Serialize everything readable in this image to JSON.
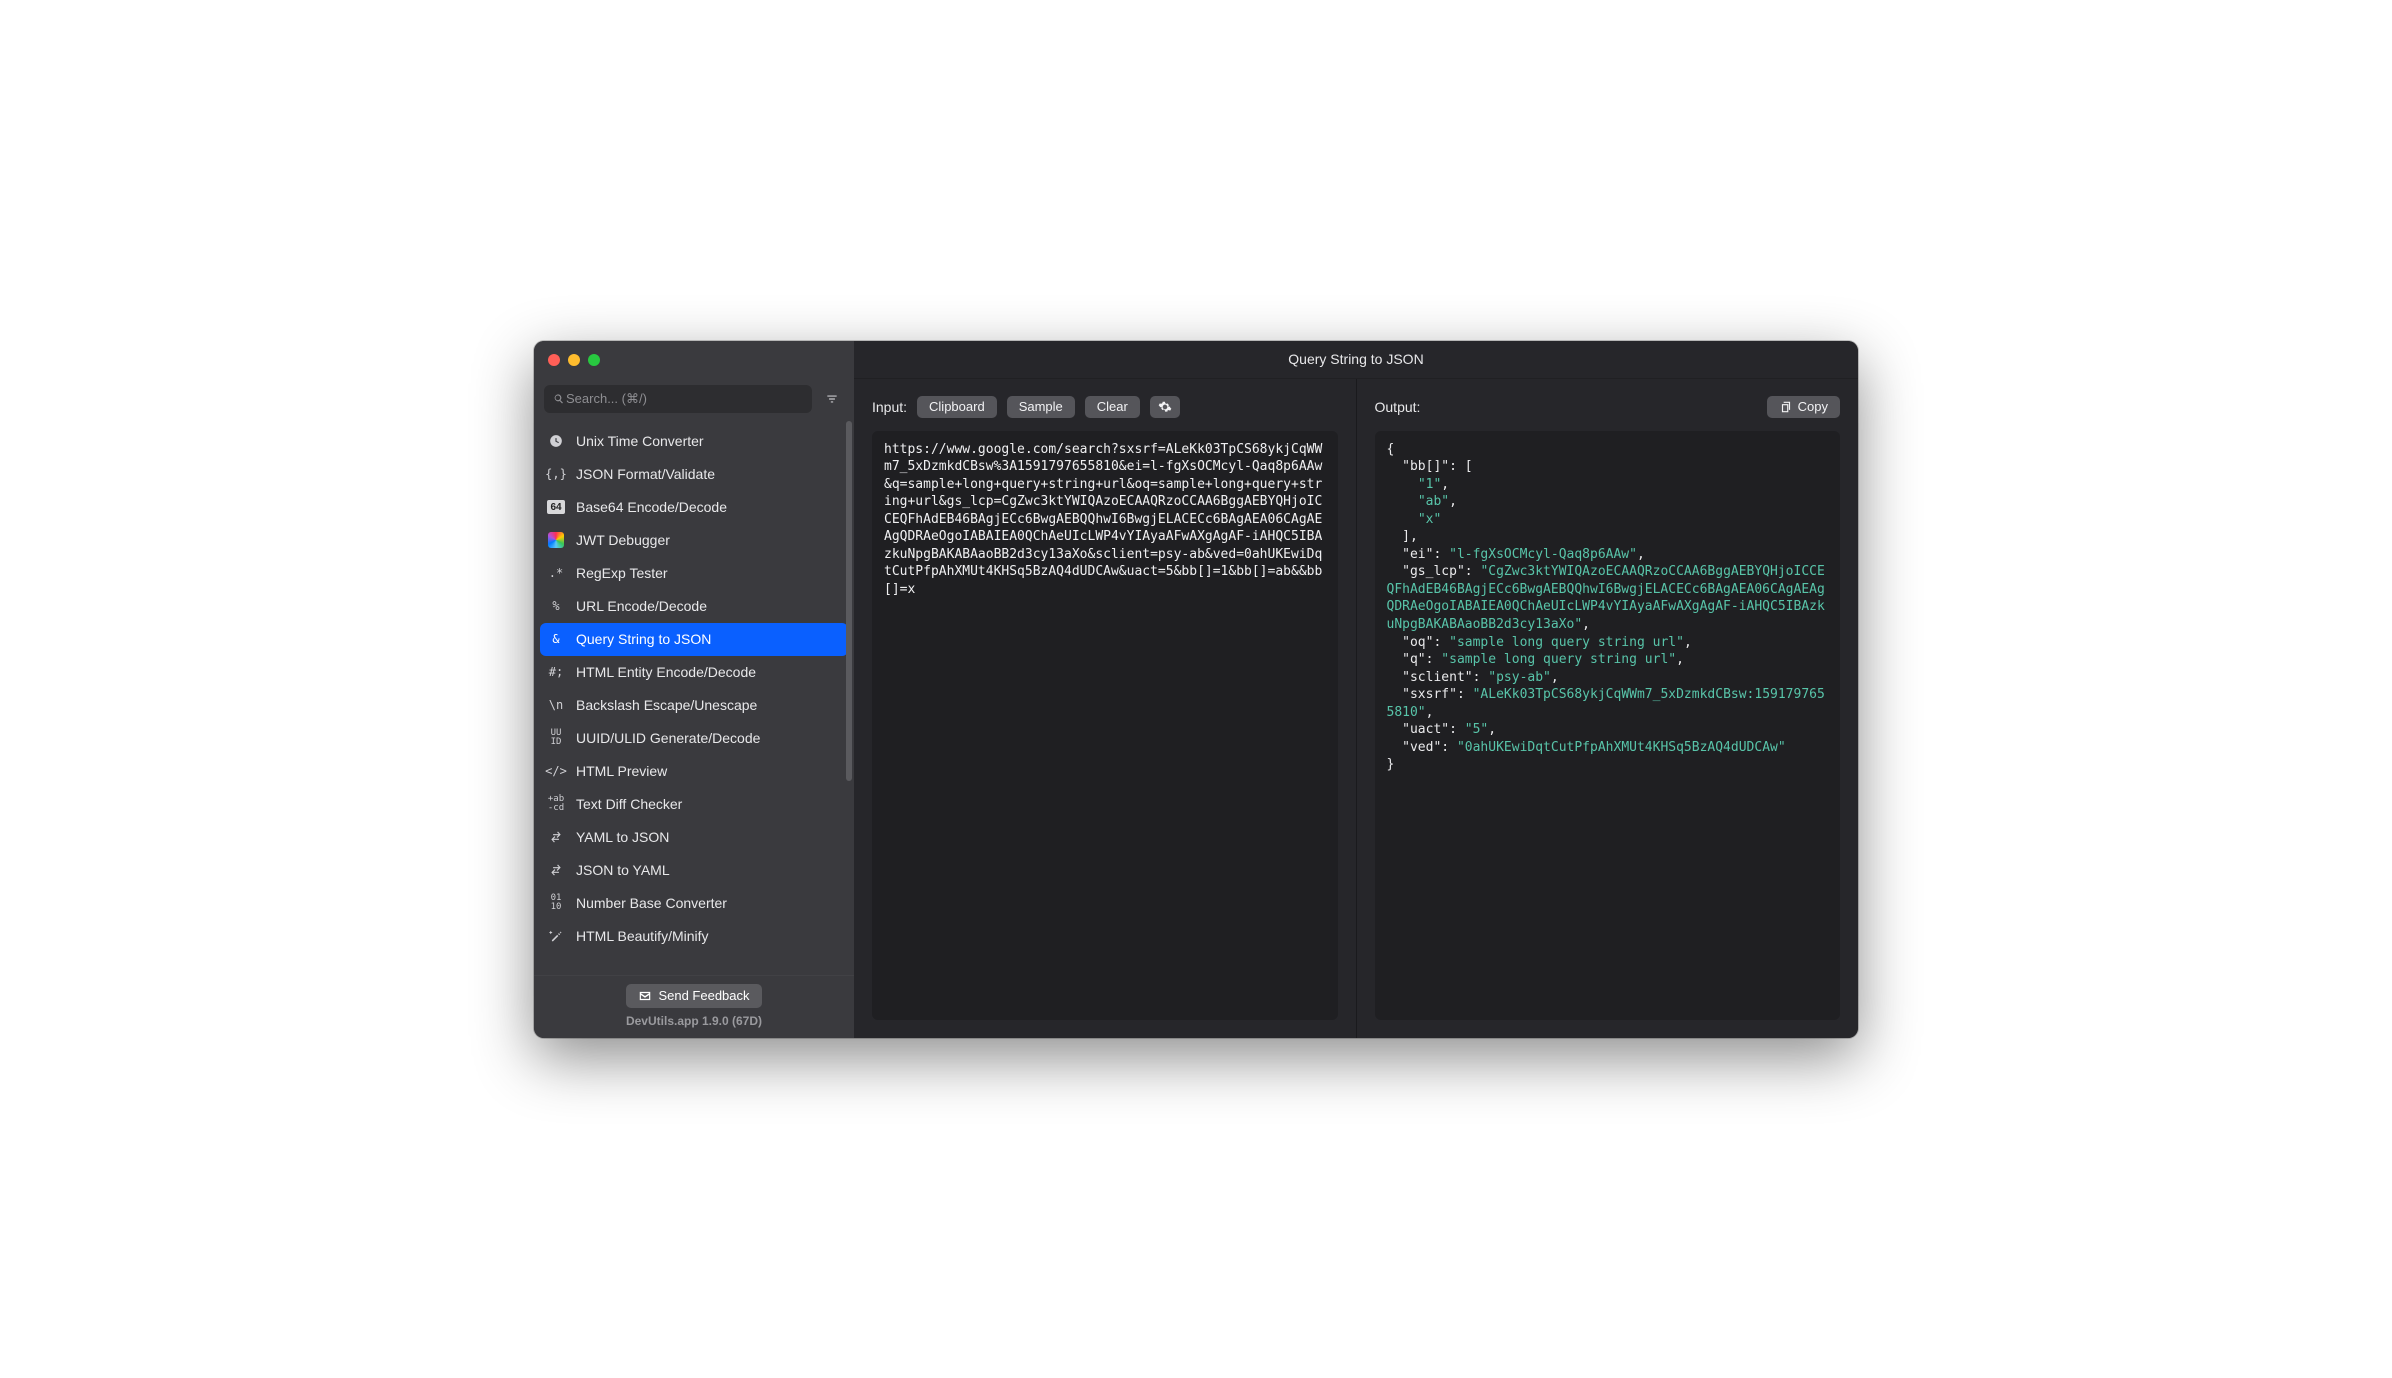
{
  "title": "Query String to JSON",
  "search": {
    "placeholder": "Search... (⌘/)"
  },
  "tools": [
    {
      "id": "unix-time",
      "label": "Unix Time Converter",
      "icon": "clock"
    },
    {
      "id": "json-format",
      "label": "JSON Format/Validate",
      "icon": "braces"
    },
    {
      "id": "base64",
      "label": "Base64 Encode/Decode",
      "icon": "b64"
    },
    {
      "id": "jwt",
      "label": "JWT Debugger",
      "icon": "jwt"
    },
    {
      "id": "regexp",
      "label": "RegExp Tester",
      "icon": "regex"
    },
    {
      "id": "url-encode",
      "label": "URL Encode/Decode",
      "icon": "percent"
    },
    {
      "id": "query-json",
      "label": "Query String to JSON",
      "icon": "amp",
      "selected": true
    },
    {
      "id": "html-entity",
      "label": "HTML Entity Encode/Decode",
      "icon": "hash"
    },
    {
      "id": "backslash",
      "label": "Backslash Escape/Unescape",
      "icon": "backslash"
    },
    {
      "id": "uuid",
      "label": "UUID/ULID Generate/Decode",
      "icon": "uuid"
    },
    {
      "id": "html-preview",
      "label": "HTML Preview",
      "icon": "tag"
    },
    {
      "id": "text-diff",
      "label": "Text Diff Checker",
      "icon": "diff"
    },
    {
      "id": "yaml-json",
      "label": "YAML to JSON",
      "icon": "swap"
    },
    {
      "id": "json-yaml",
      "label": "JSON to YAML",
      "icon": "swap"
    },
    {
      "id": "number-base",
      "label": "Number Base Converter",
      "icon": "bits"
    },
    {
      "id": "html-beautify",
      "label": "HTML Beautify/Minify",
      "icon": "wand"
    }
  ],
  "feedback_label": "Send Feedback",
  "version": "DevUtils.app 1.9.0 (67D)",
  "input": {
    "label": "Input:",
    "buttons": {
      "clipboard": "Clipboard",
      "sample": "Sample",
      "clear": "Clear"
    },
    "text": "https://www.google.com/search?sxsrf=ALeKk03TpCS68ykjCqWWm7_5xDzmkdCBsw%3A1591797655810&ei=l-fgXsOCMcyl-Qaq8p6AAw&q=sample+long+query+string+url&oq=sample+long+query+string+url&gs_lcp=CgZwc3ktYWIQAzoECAAQRzoCCAA6BggAEBYQHjoICCEQFhAdEB46BAgjECc6BwgAEBQQhwI6BwgjELACECc6BAgAEA06CAgAEAgQDRAeOgoIABAIEA0QChAeUIcLWP4vYIAyaAFwAXgAgAF-iAHQC5IBAzkuNpgBAKABAaoBB2d3cy13aXo&sclient=psy-ab&ved=0ahUKEwiDqtCutPfpAhXMUt4KHSq5BzAQ4dUDCAw&uact=5&bb[]=1&bb[]=ab&&bb[]=x"
  },
  "output": {
    "label": "Output:",
    "copy_label": "Copy",
    "json": {
      "bb[]": [
        "1",
        "ab",
        "x"
      ],
      "ei": "l-fgXsOCMcyl-Qaq8p6AAw",
      "gs_lcp": "CgZwc3ktYWIQAzoECAAQRzoCCAA6BggAEBYQHjoICCEQFhAdEB46BAgjECc6BwgAEBQQhwI6BwgjELACECc6BAgAEA06CAgAEAgQDRAeOgoIABAIEA0QChAeUIcLWP4vYIAyaAFwAXgAgAF-iAHQC5IBAzkuNpgBAKABAaoBB2d3cy13aXo",
      "oq": "sample long query string url",
      "q": "sample long query string url",
      "sclient": "psy-ab",
      "sxsrf": "ALeKk03TpCS68ykjCqWWm7_5xDzmkdCBsw:1591797655810",
      "uact": "5",
      "ved": "0ahUKEwiDqtCutPfpAhXMUt4KHSq5BzAQ4dUDCAw"
    }
  }
}
